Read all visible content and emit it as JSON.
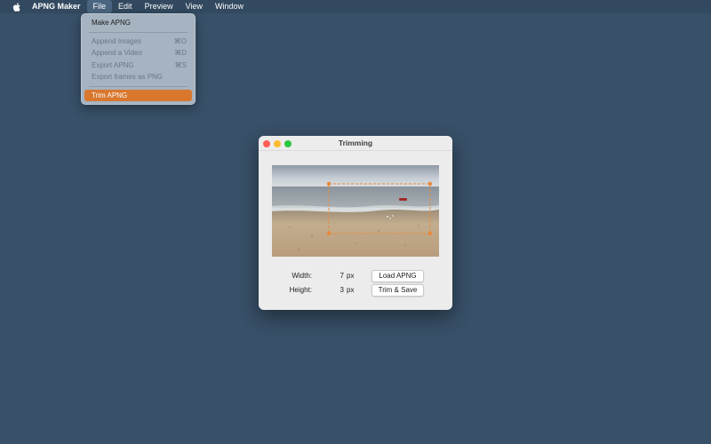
{
  "menubar": {
    "apple_icon": "apple-logo-icon",
    "app_name": "APNG Maker",
    "items": [
      "File",
      "Edit",
      "Preview",
      "View",
      "Window"
    ]
  },
  "file_menu": {
    "make": "Make APNG",
    "append_images": "Append Images",
    "append_images_shortcut": "⌘O",
    "append_video": "Append a Video",
    "append_video_shortcut": "⌘D",
    "export_apng": "Export APNG",
    "export_apng_shortcut": "⌘S",
    "export_frames": "Export frames as PNG",
    "trim": "Trim APNG"
  },
  "window": {
    "title": "Trimming",
    "width_label": "Width:",
    "width_value": "7",
    "height_label": "Height:",
    "height_value": "3",
    "unit": "px",
    "load_button": "Load APNG",
    "trim_button": "Trim & Save"
  },
  "colors": {
    "desktop": "#385068",
    "menu_highlight": "#d9772f",
    "crop_handle": "#e8893a"
  }
}
